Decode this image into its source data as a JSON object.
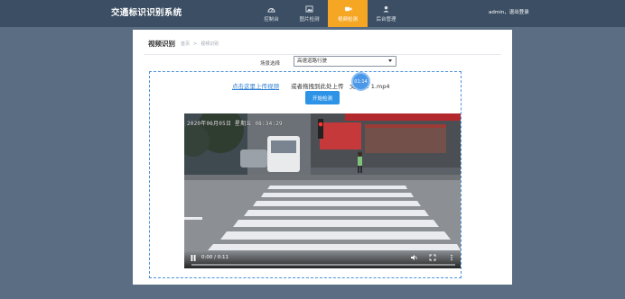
{
  "app": {
    "title": "交通标识识别系统"
  },
  "nav": {
    "items": [
      {
        "label": "控制台",
        "icon": "dashboard-icon"
      },
      {
        "label": "图片检测",
        "icon": "image-icon"
      },
      {
        "label": "视频检测",
        "icon": "video-camera-icon",
        "active": true
      },
      {
        "label": "后台管理",
        "icon": "user-icon"
      }
    ]
  },
  "user": {
    "text": "admin，退出登录"
  },
  "page": {
    "title": "视频识别",
    "breadcrumb": [
      "首页",
      ">",
      "视频识别"
    ]
  },
  "scene": {
    "label": "场景选择",
    "selected": "高速道路行驶"
  },
  "upload": {
    "link_label": "点击这里上传视频",
    "drag_text": "或者拖拽到此处上传",
    "file_label": "文件名: 1.mp4",
    "timer": "01:14",
    "start_label": "开始检测"
  },
  "video": {
    "osd_text": "2020年06月05日 星期五 08:34:29",
    "time_text": "0:00 / 0:11",
    "progress": 0.0
  },
  "colors": {
    "accent": "#f5a623",
    "primary": "#2d93e6",
    "topbar": "#3c4e63",
    "background": "#5a6d83"
  }
}
